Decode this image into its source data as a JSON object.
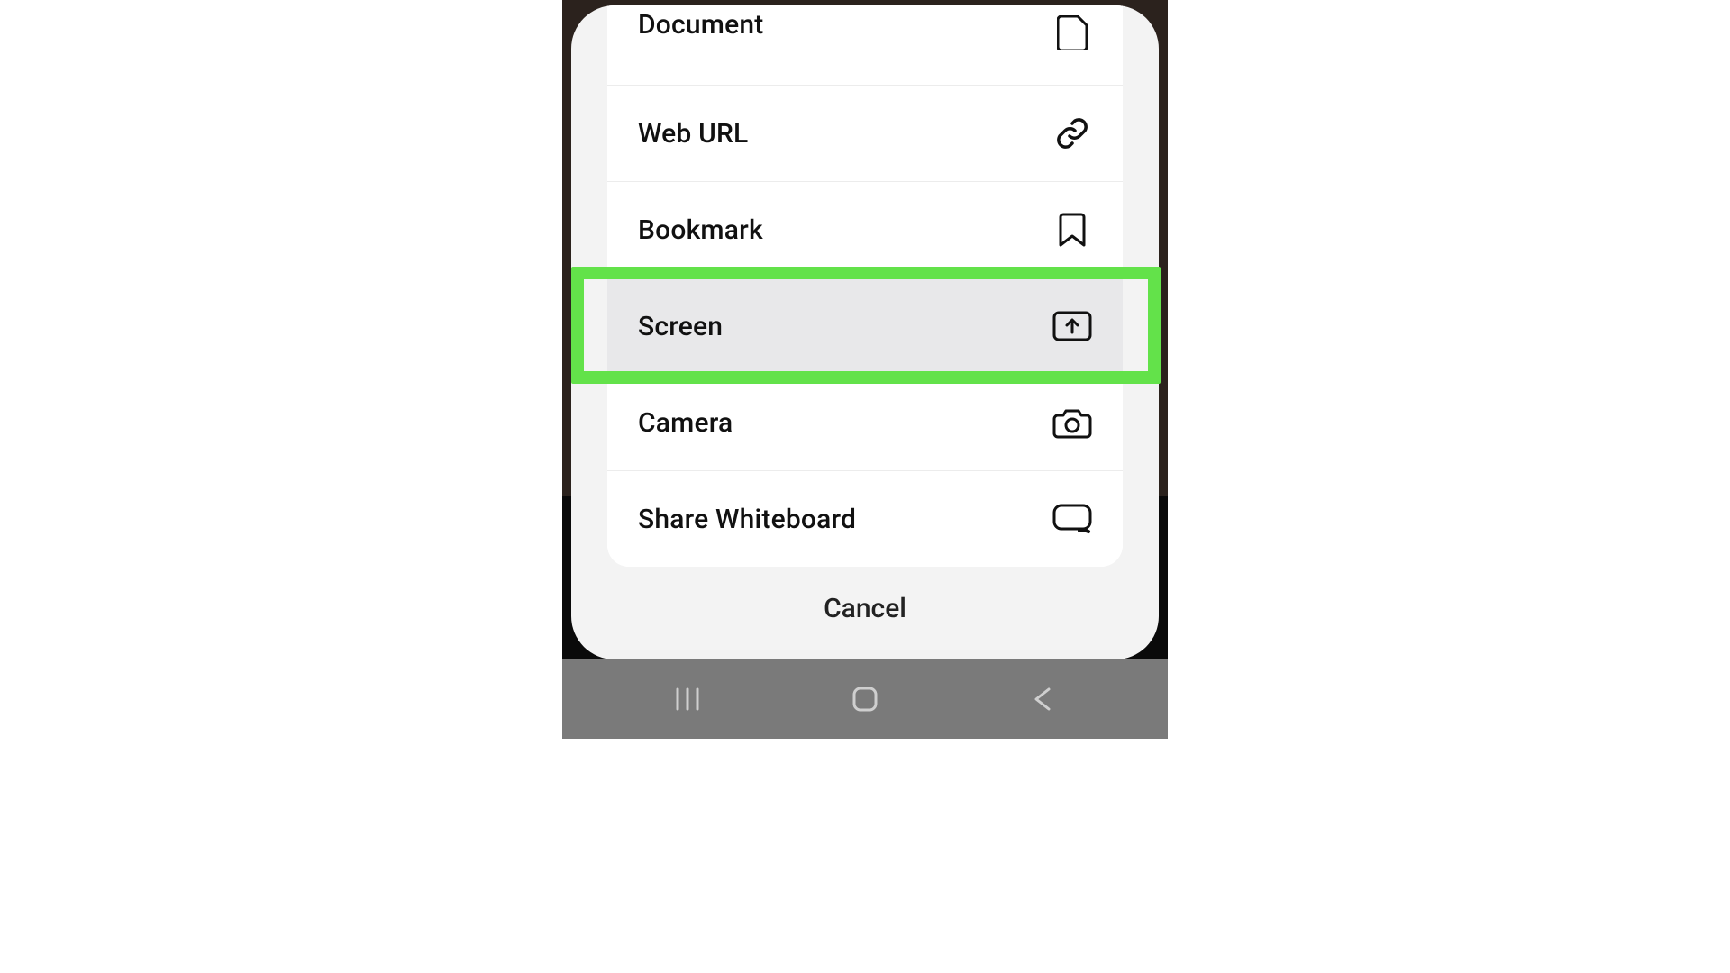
{
  "menu": {
    "items": [
      {
        "key": "document",
        "label": "Document",
        "icon": "document-icon"
      },
      {
        "key": "web_url",
        "label": "Web URL",
        "icon": "link-icon"
      },
      {
        "key": "bookmark",
        "label": "Bookmark",
        "icon": "bookmark-icon"
      },
      {
        "key": "screen",
        "label": "Screen",
        "icon": "share-screen-icon",
        "highlighted": true
      },
      {
        "key": "camera",
        "label": "Camera",
        "icon": "camera-icon"
      },
      {
        "key": "whiteboard",
        "label": "Share Whiteboard",
        "icon": "whiteboard-icon"
      }
    ],
    "cancel_label": "Cancel"
  },
  "navbar": {
    "recents": "recents-icon",
    "home": "home-icon",
    "back": "back-icon"
  },
  "colors": {
    "highlight": "#63e24a",
    "sheet_bg": "#f3f3f3",
    "row_sel": "#e8e8ea",
    "navbar": "#7a7a7a"
  }
}
